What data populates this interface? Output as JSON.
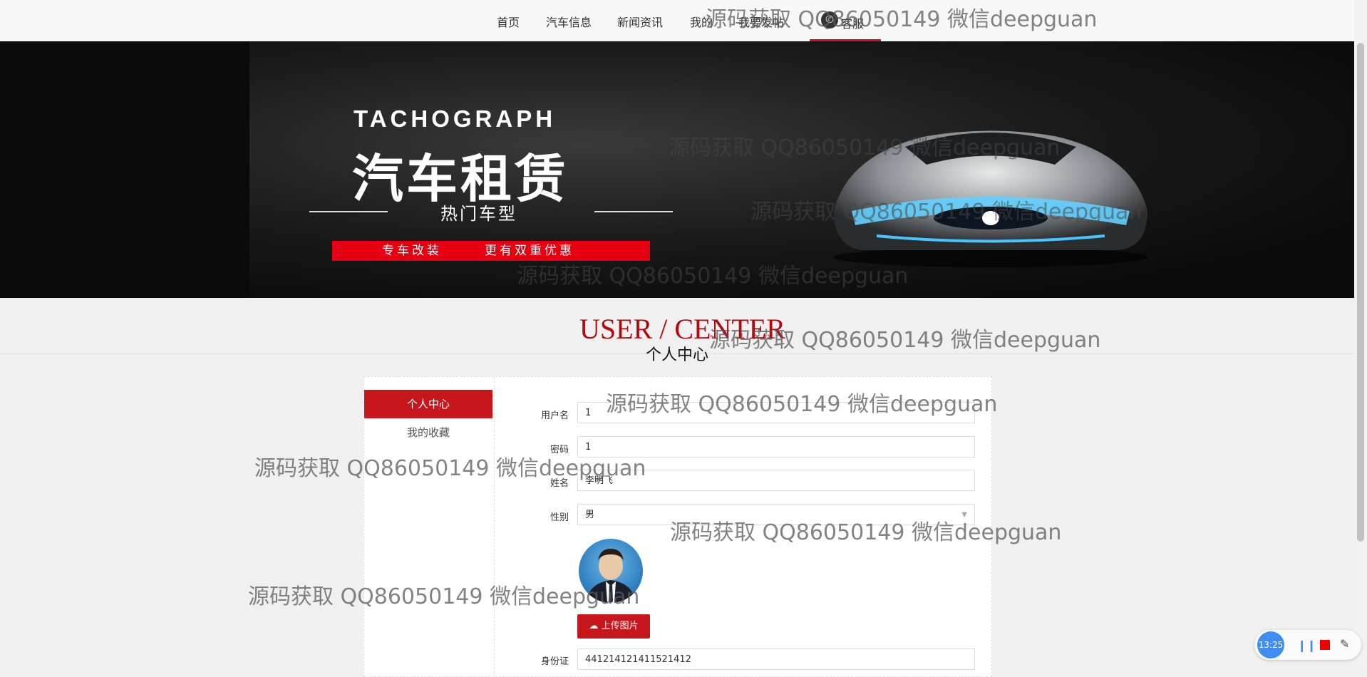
{
  "nav": {
    "items": [
      "首页",
      "汽车信息",
      "新闻资讯",
      "我的",
      "我要发帖",
      "客服"
    ],
    "active_label": "客服"
  },
  "banner": {
    "title_en": "TACHOGRAPH",
    "title_cn": "汽车租赁",
    "subtitle": "热门车型",
    "promo_left": "专车改装",
    "promo_right": "更有双重优惠"
  },
  "user_center": {
    "title_en": "USER / CENTER",
    "title_cn": "个人中心"
  },
  "sidebar": {
    "active": "个人中心",
    "items": [
      "我的收藏"
    ]
  },
  "form": {
    "username_label": "用户名",
    "username_value": "1",
    "password_label": "密码",
    "password_value": "1",
    "name_label": "姓名",
    "name_value": "李明飞",
    "gender_label": "性别",
    "gender_value": "男",
    "upload_label": "上传图片",
    "id_label": "身份证",
    "id_value": "441214121411521412"
  },
  "watermark": "源码获取 QQ86050149 微信deepguan",
  "recorder": {
    "time": "13:25"
  },
  "colors": {
    "accent": "#c8161d",
    "banner_bg": "#0b0b0b"
  }
}
